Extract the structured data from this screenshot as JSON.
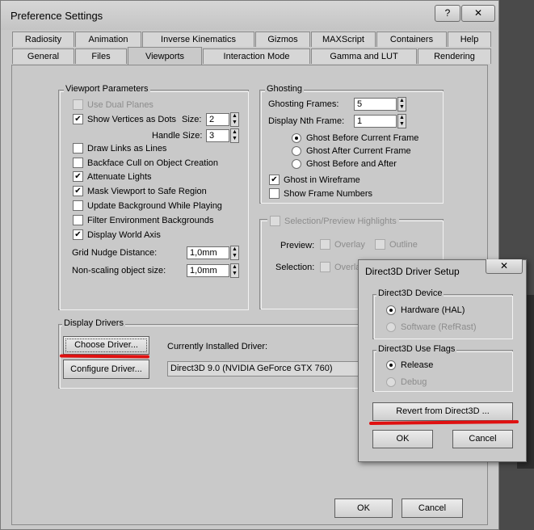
{
  "window": {
    "title": "Preference Settings",
    "help_btn": "?",
    "close_btn": "✕"
  },
  "tabs_row1": [
    "Radiosity",
    "Animation",
    "Inverse Kinematics",
    "Gizmos",
    "MAXScript",
    "Containers",
    "Help"
  ],
  "tabs_row2": [
    "General",
    "Files",
    "Viewports",
    "Interaction Mode",
    "Gamma and LUT",
    "Rendering"
  ],
  "active_tab": "Viewports",
  "viewport_params": {
    "title": "Viewport Parameters",
    "use_dual_planes": "Use Dual Planes",
    "show_vertices": "Show Vertices as Dots",
    "size_label": "Size:",
    "size_value": "2",
    "handle_size_label": "Handle Size:",
    "handle_size_value": "3",
    "draw_links": "Draw Links as Lines",
    "backface_cull": "Backface Cull on Object Creation",
    "attenuate_lights": "Attenuate Lights",
    "mask_viewport": "Mask Viewport to Safe Region",
    "update_background": "Update Background While Playing",
    "filter_env": "Filter Environment Backgrounds",
    "display_world_axis": "Display World Axis",
    "grid_nudge_label": "Grid Nudge Distance:",
    "grid_nudge_value": "1,0mm",
    "nonscaling_label": "Non-scaling object size:",
    "nonscaling_value": "1,0mm"
  },
  "ghosting": {
    "title": "Ghosting",
    "frames_label": "Ghosting Frames:",
    "frames_value": "5",
    "nth_label": "Display Nth Frame:",
    "nth_value": "1",
    "before": "Ghost Before Current Frame",
    "after": "Ghost After Current Frame",
    "before_after": "Ghost Before and After",
    "wireframe": "Ghost in Wireframe",
    "show_numbers": "Show Frame Numbers"
  },
  "selection": {
    "title": "Selection/Preview Highlights",
    "preview_label": "Preview:",
    "selection_label": "Selection:",
    "overlay": "Overlay",
    "outline": "Outline",
    "overlay_cut": "Overla"
  },
  "display_drivers": {
    "title": "Display Drivers",
    "choose_driver": "Choose Driver...",
    "configure_driver": "Configure Driver...",
    "installed_label": "Currently Installed Driver:",
    "installed_value": "Direct3D 9.0 (NVIDIA GeForce GTX 760)"
  },
  "footer": {
    "ok": "OK",
    "cancel": "Cancel"
  },
  "d3d_dialog": {
    "title": "Direct3D Driver Setup",
    "close": "✕",
    "device_title": "Direct3D Device",
    "hardware": "Hardware (HAL)",
    "software": "Software (RefRast)",
    "flags_title": "Direct3D Use Flags",
    "release": "Release",
    "debug": "Debug",
    "revert": "Revert from Direct3D ...",
    "ok": "OK",
    "cancel": "Cancel"
  },
  "colors": {
    "annotation_red": "#e01010",
    "window_bg": "#c9c9c9"
  }
}
